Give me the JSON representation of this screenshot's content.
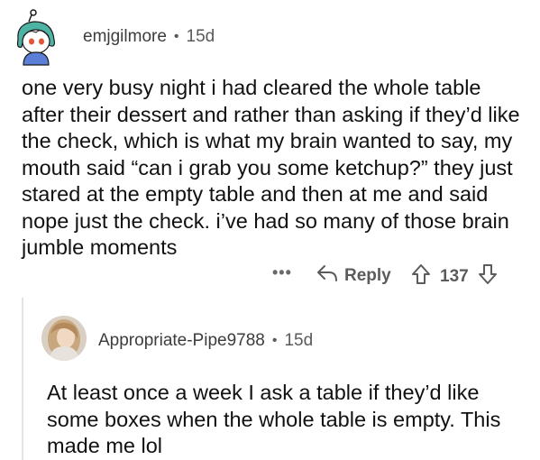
{
  "comment": {
    "username": "emjgilmore",
    "separator": "•",
    "age": "15d",
    "body": "one very busy night i had cleared the whole table after their dessert and rather than asking if they’d like the check, which is what my brain wanted to say, my mouth said “can i grab you some ketchup?” they just stared at the empty table and then at me and said nope just the check. i’ve had so many of those brain jumble moments",
    "actions": {
      "more_label": "•••",
      "reply_label": "Reply",
      "score": "137"
    }
  },
  "reply": {
    "username": "Appropriate-Pipe9788",
    "separator": "•",
    "age": "15d",
    "body": "At least once a week I ask a table if they’d like some boxes when the whole table is empty. This made me lol"
  },
  "icons": {
    "reply": "reply-arrow-icon",
    "upvote": "upvote-arrow-icon",
    "downvote": "downvote-arrow-icon",
    "more": "more-options-icon"
  }
}
